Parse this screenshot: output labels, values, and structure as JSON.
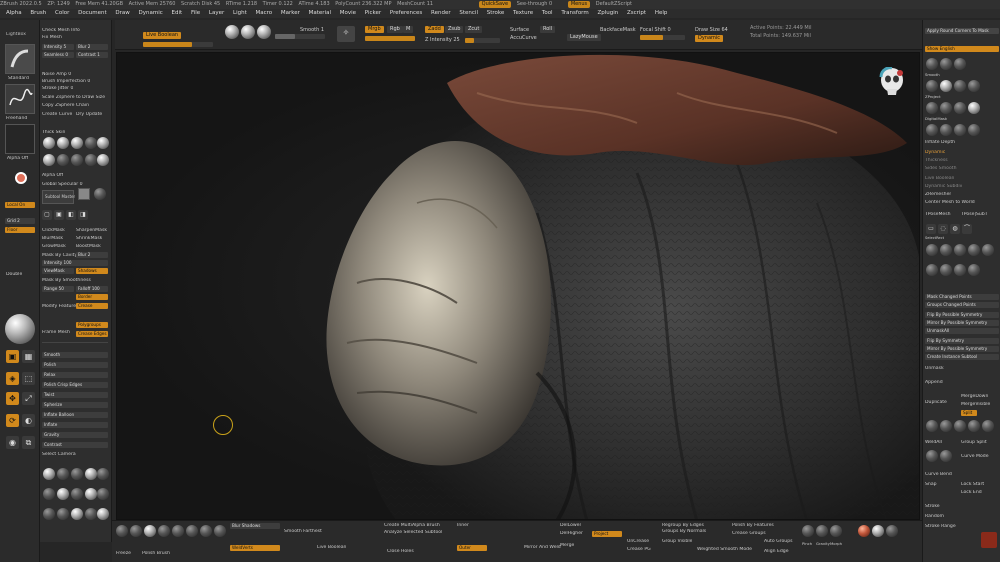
{
  "titlebar": {
    "items": [
      "ZBrush 2022.0.5",
      "ZP: 1249",
      "Free Mem 41.20GB",
      "Active Mem 25760",
      "Scratch Disk 45",
      "RTime 1.218",
      "Timer 0.122",
      "ATime 4.183",
      "PolyCount 236.322 MP",
      "MeshCount 11"
    ],
    "quicksave": "QuickSave",
    "seethrough": "See-through 0",
    "menus_btn": "Menus",
    "ui_label": "DefaultZScript"
  },
  "menubar": [
    "Alpha",
    "Brush",
    "Color",
    "Document",
    "Draw",
    "Dynamic",
    "Edit",
    "File",
    "Layer",
    "Light",
    "Macro",
    "Marker",
    "Material",
    "Movie",
    "Picker",
    "Preferences",
    "Render",
    "Stencil",
    "Stroke",
    "Texture",
    "Tool",
    "Transform",
    "Zplugin",
    "Zscript",
    "Help"
  ],
  "topshelf": {
    "lightbox": "LightBox",
    "tool_label": "Live Boolean",
    "zadd": "Zadd",
    "zsub": "Zsub",
    "zcut": "Zcut",
    "mrgb": "Mrgb",
    "rgb": "Rgb",
    "m": "M",
    "focal_shift": "Focal Shift 0",
    "draw_size": "Draw Size 64",
    "dynamic": "Dynamic",
    "rgb_intensity": "Rgb Intensity 100",
    "z_intensity": "Z Intensity 25",
    "active_points": "Active Points: 22.449 Mil",
    "total_points": "Total Points: 149.637 Mil",
    "surface": "Surface",
    "accucurve": "AccuCurve",
    "backface": "BackfaceMask",
    "lazymouse": "LazyMouse",
    "roll": "Roll",
    "smoothit": "Smooth 1"
  },
  "leftpanel": {
    "rows": [
      "Check Mesh Info",
      "Fix Mesh",
      "Intensity 5",
      "Blur 2",
      "Seamless 0",
      "Contrast 1",
      "Noise Amp 0",
      "Brush Imperfection 0",
      "Stroke Jitter 0",
      "Scale Zsphere to Draw Size",
      "Copy ZSphere Chain",
      "Create Curve",
      "Dry Update",
      "Thick Skin",
      "Alpha Off",
      "Global Specular 0",
      "Subtool Master",
      "ClickMask",
      "SharpenMask",
      "BlurMask",
      "ShrinkMask",
      "GrowMask",
      "BoostMask",
      "Mask By Cavity",
      "Blur 2",
      "Intensity 100",
      "ViewMask",
      "Shadows",
      "Mask By Smoothness",
      "Range 50",
      "Falloff 100",
      "Modify Feature",
      "Border",
      "Crease",
      "Frame Mesh",
      "Polygroups",
      "Crease Edges",
      "Smooth",
      "Polish",
      "Relax",
      "Polish Crisp Edges",
      "Twist",
      "Spherize",
      "Inflate Balloon",
      "Inflate",
      "Gravity",
      "Contrast",
      "Select Camera"
    ],
    "tray": [
      "Standard",
      "Freehand",
      "Alpha Off",
      "Local On",
      "Grid 2",
      "Floor",
      "Double",
      "Persp",
      "Spix 3",
      "Frame",
      "Move",
      "Scale",
      "Rotate",
      "Transp",
      "Solo"
    ]
  },
  "rightpanel": {
    "rows": [
      "Apply Round Corners To Mask",
      "Show English",
      "Smooth",
      "Smooth Direct",
      "Smooth Stronger",
      "ZProject",
      "Trim Adaptive",
      "IMM_Model Parts",
      "DigitalMask",
      "HL_Sculpt",
      "Dam_Standard",
      "IMM_BoolFlats",
      "Pinch",
      "Polish",
      "Inflate Depth",
      "Dynamic",
      "Thickness",
      "Sides Smooth",
      "Live Boolean",
      "Dynamic Subdiv",
      "ZRemesher",
      "Center Mesh to World",
      "TPoseMesh",
      "TPose|SubT",
      "SelectRect",
      "SelectLasso",
      "MaskLasso",
      "ClipCurve",
      "MaskPen",
      "MaskCurve",
      "Curve Tube",
      "Curve Snake",
      "Mask Changed Points",
      "Groups Changed Points",
      "Flip By Possible Symmetry",
      "Mirror By Possible Symmetry",
      "UnmaskAll",
      "Flip By Symmetry",
      "Mirror By Possible Symmetry",
      "Create Instance Subtool",
      "Unmask",
      "Append",
      "Duplicate",
      "MergeDown",
      "MergeVisible",
      "Split",
      "WeldAll",
      "Group Split",
      "Curve Mode",
      "Curve Bend",
      "Snap",
      "Lock Start",
      "Lock End",
      "Stroke",
      "Random",
      "Stroke Range"
    ]
  },
  "bottomshelf": {
    "items": [
      "Freeze",
      "Polish Brush",
      "Blur Shadows",
      "WeldVerts",
      "Smooth Farthest",
      "Create MultiAlpha Brush",
      "Analyze Selected Subtool",
      "Inner",
      "Outer",
      "Mirror And Weld",
      "DelLower",
      "DelHigher",
      "Close Holes",
      "Project",
      "Merge",
      "Groups By Normals",
      "UnCrease",
      "Crease PG",
      "Group Visible",
      "Regroup By Edges",
      "Polish By Features",
      "Auto Groups",
      "Pinch",
      "Gravity",
      "Morph",
      "Live Boolean",
      "Crease Groups",
      "Weighted Smooth Mode",
      "Align Edge"
    ]
  },
  "colors": {
    "accent": "#d1891c",
    "panel": "#2e2e2e",
    "viewport": "#161616"
  }
}
